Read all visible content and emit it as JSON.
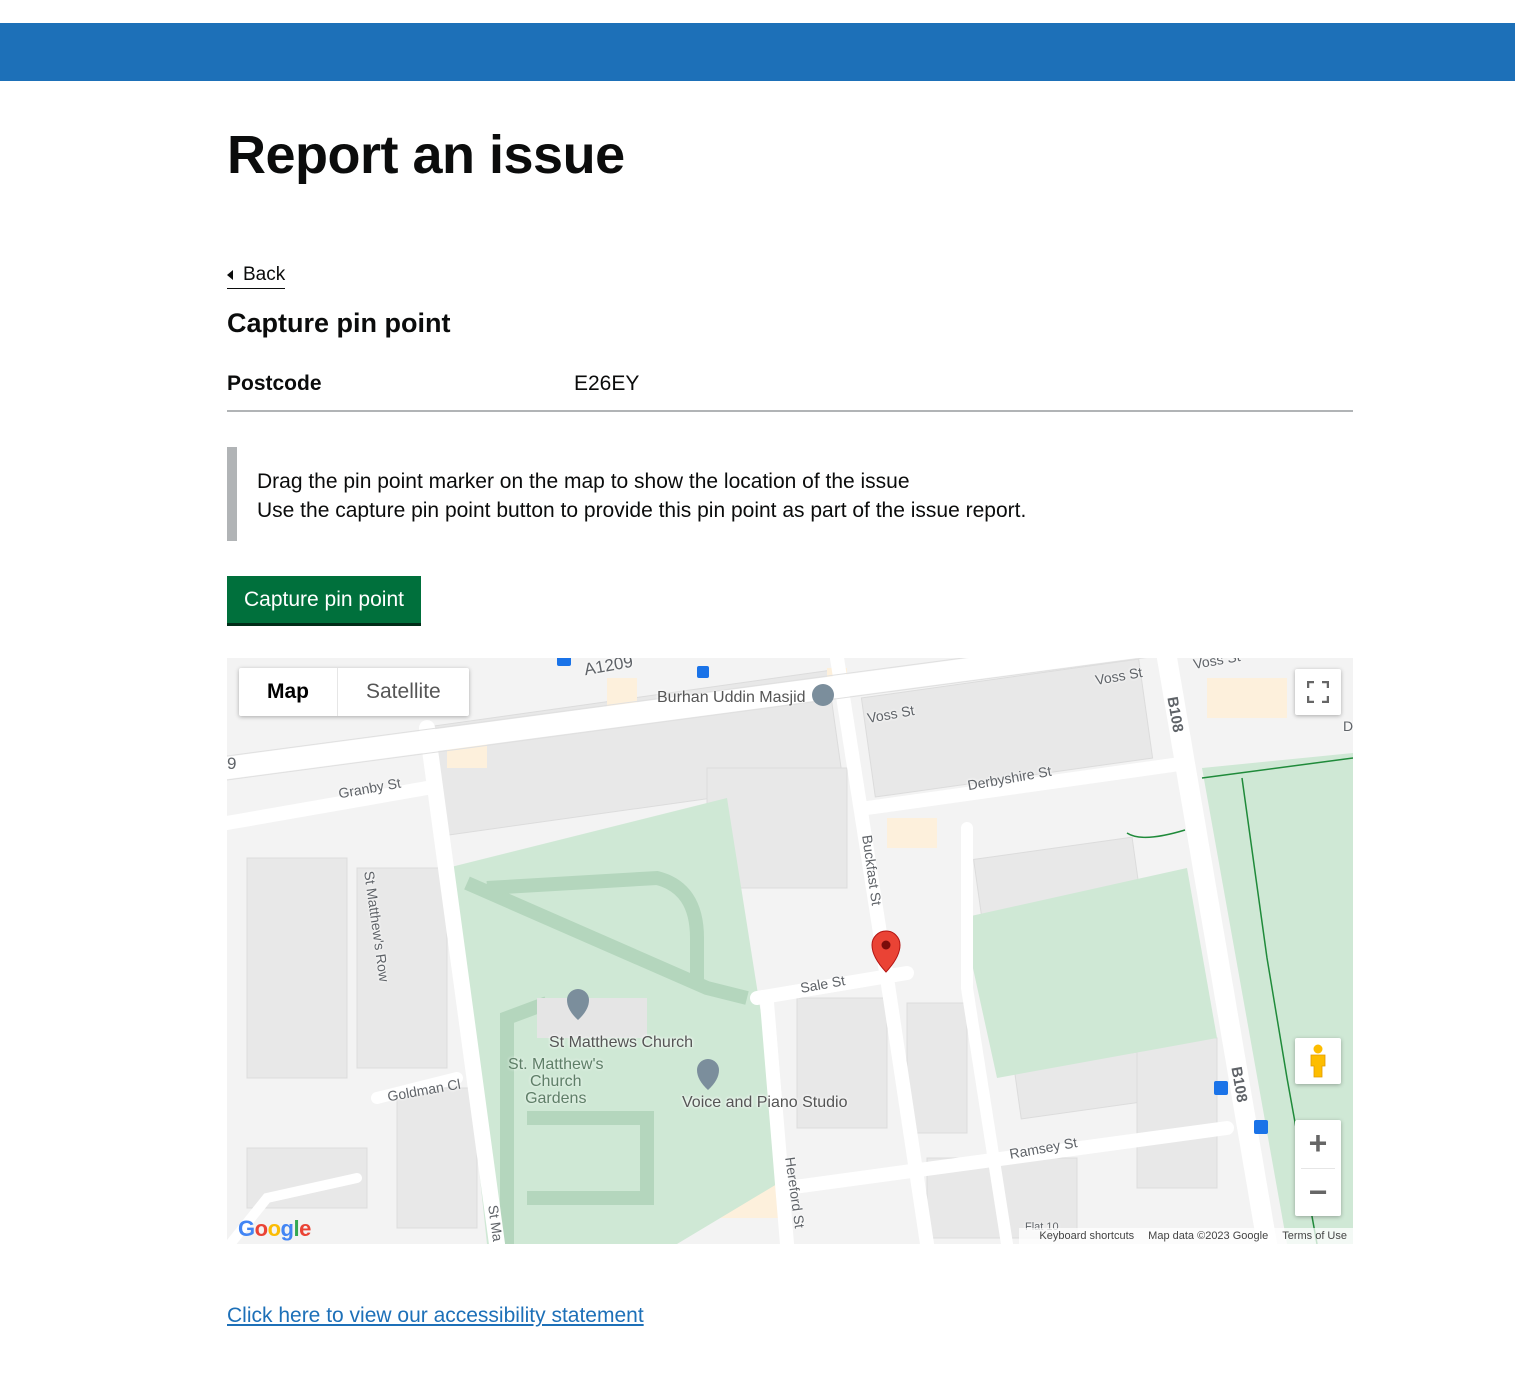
{
  "page": {
    "title": "Report an issue",
    "back_label": "Back",
    "section_heading": "Capture pin point",
    "accessibility_link": "Click here to view our accessibility statement"
  },
  "summary": {
    "key": "Postcode",
    "value": "E26EY"
  },
  "inset": {
    "line1": "Drag the pin point marker on the map to show the location of the issue",
    "line2": "Use the capture pin point button to provide this pin point as part of the issue report."
  },
  "capture_button": "Capture pin point",
  "map": {
    "type_options": [
      "Map",
      "Satellite"
    ],
    "active_type": "Map",
    "icons": {
      "fullscreen": "fullscreen-icon",
      "pegman": "pegman-icon",
      "zoom_in": "+",
      "zoom_out": "−",
      "marker": "map-pin-icon"
    },
    "google_logo": "Google",
    "attribution": [
      "Keyboard shortcuts",
      "Map data ©2023 Google",
      "Terms of Use"
    ],
    "street_labels": [
      "A1209",
      "Voss St",
      "Voss St",
      "Voss St",
      "B108",
      "B108",
      "Derbyshire St",
      "Granby St",
      "St Matthew's Row",
      "Buckfast St",
      "Sale St",
      "Goldman Cl",
      "Ramsey St",
      "Hereford St",
      "St Ma",
      "9",
      "D",
      "Flat 10"
    ],
    "poi_labels": [
      "Burhan Uddin Masjid",
      "St Matthews Church",
      "Voice and Piano Studio"
    ],
    "park_label": [
      "St. Matthew's",
      "Church",
      "Gardens"
    ]
  },
  "colors": {
    "header": "#1d70b8",
    "button": "#00703c",
    "link": "#1d70b8",
    "park": "#cde8d4",
    "marker": "#ea4335"
  }
}
